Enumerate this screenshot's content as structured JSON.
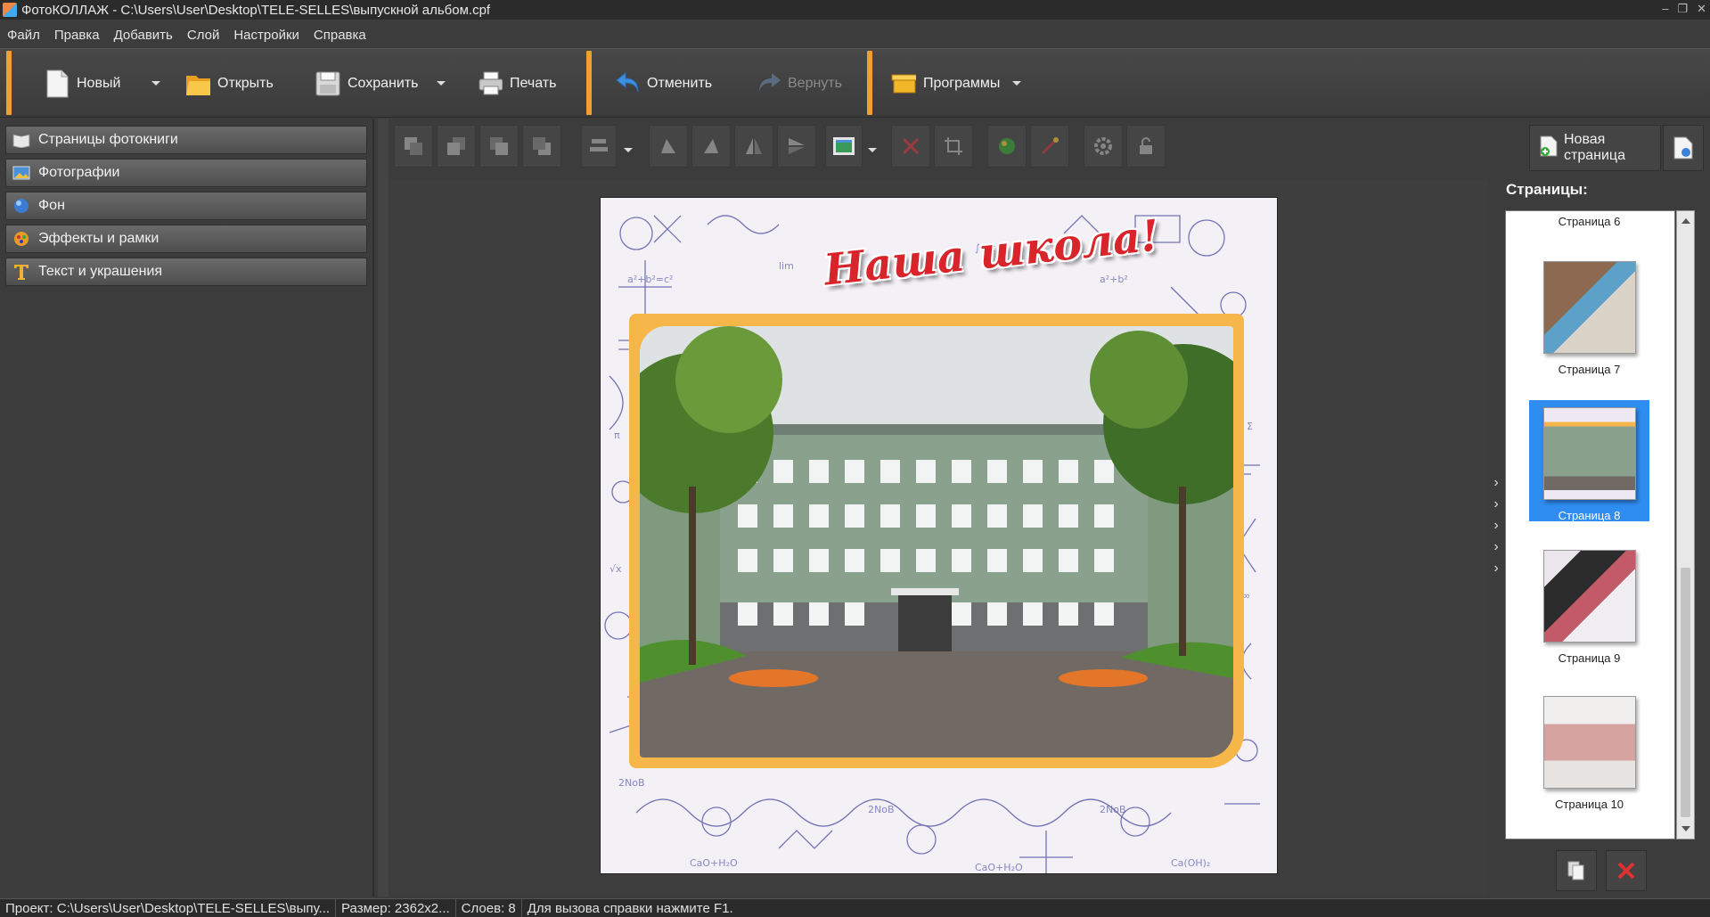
{
  "window": {
    "title": "ФотоКОЛЛАЖ - C:\\Users\\User\\Desktop\\TELE-SELLES\\выпускной альбом.cpf",
    "controls": [
      "–",
      "❐",
      "✕"
    ]
  },
  "menu": [
    "Файл",
    "Правка",
    "Добавить",
    "Слой",
    "Настройки",
    "Справка"
  ],
  "toolbar": {
    "new_label": "Новый",
    "open_label": "Открыть",
    "save_label": "Сохранить",
    "print_label": "Печать",
    "undo_label": "Отменить",
    "redo_label": "Вернуть",
    "programs_label": "Программы"
  },
  "left_panel": {
    "items": [
      {
        "label": "Страницы фотокниги",
        "icon": "book-icon"
      },
      {
        "label": "Фотографии",
        "icon": "photos-icon"
      },
      {
        "label": "Фон",
        "icon": "background-icon"
      },
      {
        "label": "Эффекты и рамки",
        "icon": "effects-icon"
      },
      {
        "label": "Текст и украшения",
        "icon": "text-icon"
      }
    ]
  },
  "edit_toolbar": {
    "new_page_label": "Новая страница"
  },
  "canvas": {
    "banner_text": "Наша школа!"
  },
  "pages_panel": {
    "title": "Страницы:",
    "pages": [
      {
        "label": "Страница 6",
        "selected": false
      },
      {
        "label": "Страница 7",
        "selected": false
      },
      {
        "label": "Страница 8",
        "selected": true
      },
      {
        "label": "Страница 9",
        "selected": false
      },
      {
        "label": "Страница 10",
        "selected": false
      }
    ]
  },
  "statusbar": {
    "project": "Проект:  C:\\Users\\User\\Desktop\\TELE-SELLES\\выпу...",
    "size": "Размер:  2362x2...",
    "layers": "Слоев:  8",
    "hint": "Для вызова справки нажмите F1."
  },
  "colors": {
    "accent": "#f0a030",
    "selection": "#2f8cf0",
    "frame": "#f7b64a",
    "banner": "#d8242a"
  }
}
